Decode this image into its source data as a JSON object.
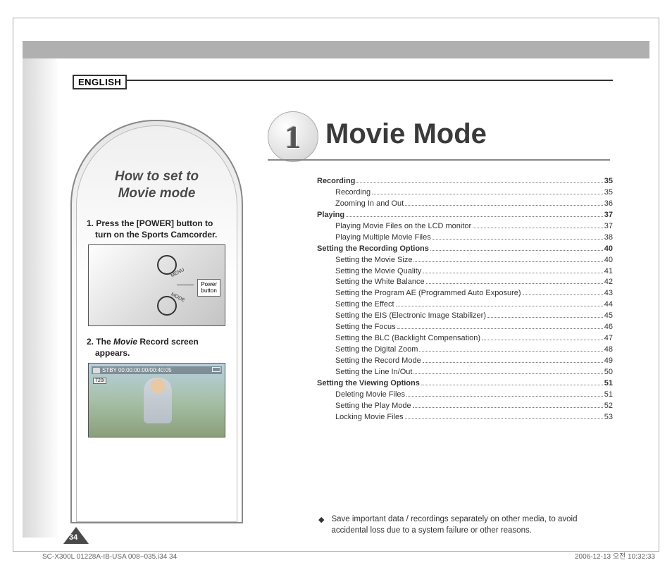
{
  "language_label": "ENGLISH",
  "chapter": {
    "number": "1",
    "title": "Movie Mode"
  },
  "sidebar": {
    "title_line1": "How to set to",
    "title_line2": "Movie mode",
    "step1": "1. Press the [POWER] button to turn on the Sports Camcorder.",
    "step2_prefix": "2. The ",
    "step2_italic": "Movie",
    "step2_suffix": " Record screen appears.",
    "power_label_l1": "Power",
    "power_label_l2": "button",
    "menu_txt": "MENU",
    "mode_txt": "MODE",
    "osd_text": "STBY 00:00:00:00/00:40:05",
    "badge_720": "720i"
  },
  "toc": [
    {
      "level": 1,
      "label": "Recording",
      "page": "35"
    },
    {
      "level": 2,
      "label": "Recording",
      "page": "35"
    },
    {
      "level": 2,
      "label": "Zooming In and Out",
      "page": "36"
    },
    {
      "level": 1,
      "label": "Playing",
      "page": "37"
    },
    {
      "level": 2,
      "label": "Playing Movie Files on the LCD monitor",
      "page": "37"
    },
    {
      "level": 2,
      "label": "Playing Multiple Movie Files",
      "page": "38"
    },
    {
      "level": 1,
      "label": "Setting the Recording Options",
      "page": "40"
    },
    {
      "level": 2,
      "label": "Setting the Movie Size",
      "page": "40"
    },
    {
      "level": 2,
      "label": "Setting the Movie Quality",
      "page": "41"
    },
    {
      "level": 2,
      "label": "Setting the White Balance",
      "page": "42"
    },
    {
      "level": 2,
      "label": "Setting the Program AE (Programmed Auto Exposure)",
      "page": "43"
    },
    {
      "level": 2,
      "label": "Setting the Effect",
      "page": "44"
    },
    {
      "level": 2,
      "label": "Setting the EIS (Electronic Image Stabilizer)",
      "page": "45"
    },
    {
      "level": 2,
      "label": "Setting the Focus",
      "page": "46"
    },
    {
      "level": 2,
      "label": "Setting the BLC (Backlight Compensation)",
      "page": "47"
    },
    {
      "level": 2,
      "label": "Setting the Digital Zoom",
      "page": "48"
    },
    {
      "level": 2,
      "label": "Setting the Record Mode",
      "page": "49"
    },
    {
      "level": 2,
      "label": "Setting the Line In/Out",
      "page": "50"
    },
    {
      "level": 1,
      "label": "Setting the Viewing Options",
      "page": "51"
    },
    {
      "level": 2,
      "label": "Deleting Movie Files",
      "page": "51"
    },
    {
      "level": 2,
      "label": "Setting the Play Mode",
      "page": "52"
    },
    {
      "level": 2,
      "label": "Locking Movie Files",
      "page": "53"
    }
  ],
  "note_text": "Save important data / recordings separately on other media, to avoid accidental loss due to a system failure or other reasons.",
  "page_number": "34",
  "footer_left": "SC-X300L 01228A-IB-USA 008~035.i34   34",
  "footer_right": "2006-12-13   오전 10:32:33"
}
